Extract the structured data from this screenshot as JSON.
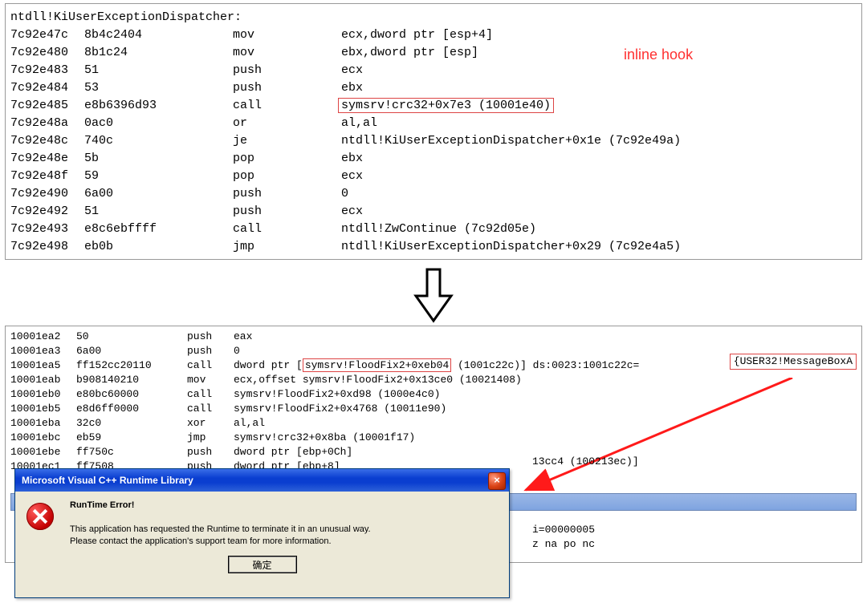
{
  "top": {
    "header": "ntdll!KiUserExceptionDispatcher:",
    "inline_hook_label": "inline hook",
    "highlight_target": "symsrv!crc32+0x7e3 (10001e40)",
    "rows": [
      {
        "addr": "7c92e47c",
        "bytes": "8b4c2404",
        "mn": "mov",
        "op": "ecx,dword ptr [esp+4]"
      },
      {
        "addr": "7c92e480",
        "bytes": "8b1c24",
        "mn": "mov",
        "op": "ebx,dword ptr [esp]"
      },
      {
        "addr": "7c92e483",
        "bytes": "51",
        "mn": "push",
        "op": "ecx"
      },
      {
        "addr": "7c92e484",
        "bytes": "53",
        "mn": "push",
        "op": "ebx"
      },
      {
        "addr": "7c92e485",
        "bytes": "e8b6396d93",
        "mn": "call",
        "op": ""
      },
      {
        "addr": "7c92e48a",
        "bytes": "0ac0",
        "mn": "or",
        "op": "al,al"
      },
      {
        "addr": "7c92e48c",
        "bytes": "740c",
        "mn": "je",
        "op": "ntdll!KiUserExceptionDispatcher+0x1e (7c92e49a)"
      },
      {
        "addr": "7c92e48e",
        "bytes": "5b",
        "mn": "pop",
        "op": "ebx"
      },
      {
        "addr": "7c92e48f",
        "bytes": "59",
        "mn": "pop",
        "op": "ecx"
      },
      {
        "addr": "7c92e490",
        "bytes": "6a00",
        "mn": "push",
        "op": "0"
      },
      {
        "addr": "7c92e492",
        "bytes": "51",
        "mn": "push",
        "op": "ecx"
      },
      {
        "addr": "7c92e493",
        "bytes": "e8c6ebffff",
        "mn": "call",
        "op": "ntdll!ZwContinue (7c92d05e)"
      },
      {
        "addr": "7c92e498",
        "bytes": "eb0b",
        "mn": "jmp",
        "op": "ntdll!KiUserExceptionDispatcher+0x29 (7c92e4a5)"
      }
    ]
  },
  "bottom": {
    "highlight_flood": "symsrv!FloodFix2+0xeb04",
    "highlight_msgbox": "{USER32!MessageBoxA",
    "flood_ds_tail": " (1001c22c)] ds:0023:1001c22c=",
    "rows": [
      {
        "addr": "10001ea2",
        "bytes": "50",
        "mn": "push",
        "op": "eax"
      },
      {
        "addr": "10001ea3",
        "bytes": "6a00",
        "mn": "push",
        "op": "0"
      },
      {
        "addr": "10001ea5",
        "bytes": "ff152cc20110",
        "mn": "call",
        "op": "dword ptr ["
      },
      {
        "addr": "10001eab",
        "bytes": "b908140210",
        "mn": "mov",
        "op": "ecx,offset symsrv!FloodFix2+0x13ce0 (10021408)"
      },
      {
        "addr": "10001eb0",
        "bytes": "e80bc60000",
        "mn": "call",
        "op": "symsrv!FloodFix2+0xd98 (1000e4c0)"
      },
      {
        "addr": "10001eb5",
        "bytes": "e8d6ff0000",
        "mn": "call",
        "op": "symsrv!FloodFix2+0x4768 (10011e90)"
      },
      {
        "addr": "10001eba",
        "bytes": "32c0",
        "mn": "xor",
        "op": "al,al"
      },
      {
        "addr": "10001ebc",
        "bytes": "eb59",
        "mn": "jmp",
        "op": "symsrv!crc32+0x8ba (10001f17)"
      },
      {
        "addr": "10001ebe",
        "bytes": "ff750c",
        "mn": "push",
        "op": "dword ptr [ebp+0Ch]"
      },
      {
        "addr": "10001ec1",
        "bytes": "ff7508",
        "mn": "push",
        "op": "dword ptr [ebp+8]"
      }
    ],
    "extra": "13cc4 (100213ec)]",
    "status": "i=00000005\nz na po nc"
  },
  "dialog": {
    "title": "Microsoft Visual C++ Runtime Library",
    "heading": "RunTime Error!",
    "body1": "This application has requested the Runtime to terminate it in an unusual way.",
    "body2": "Please contact the application's support team for more information.",
    "ok": "确定"
  }
}
